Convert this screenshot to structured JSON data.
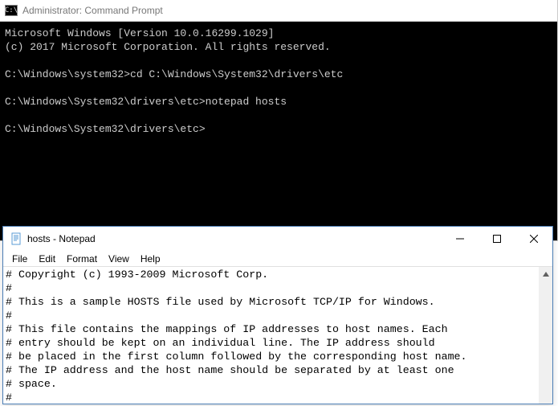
{
  "cmd": {
    "title": "Administrator: Command Prompt",
    "icon_text": "C:\\",
    "lines": [
      "Microsoft Windows [Version 10.0.16299.1029]",
      "(c) 2017 Microsoft Corporation. All rights reserved.",
      "",
      "C:\\Windows\\system32>cd C:\\Windows\\System32\\drivers\\etc",
      "",
      "C:\\Windows\\System32\\drivers\\etc>notepad hosts",
      "",
      "C:\\Windows\\System32\\drivers\\etc>"
    ]
  },
  "notepad": {
    "title": "hosts - Notepad",
    "menu": {
      "file": "File",
      "edit": "Edit",
      "format": "Format",
      "view": "View",
      "help": "Help"
    },
    "lines": [
      "# Copyright (c) 1993-2009 Microsoft Corp.",
      "#",
      "# This is a sample HOSTS file used by Microsoft TCP/IP for Windows.",
      "#",
      "# This file contains the mappings of IP addresses to host names. Each",
      "# entry should be kept on an individual line. The IP address should",
      "# be placed in the first column followed by the corresponding host name.",
      "# The IP address and the host name should be separated by at least one",
      "# space.",
      "#"
    ]
  }
}
